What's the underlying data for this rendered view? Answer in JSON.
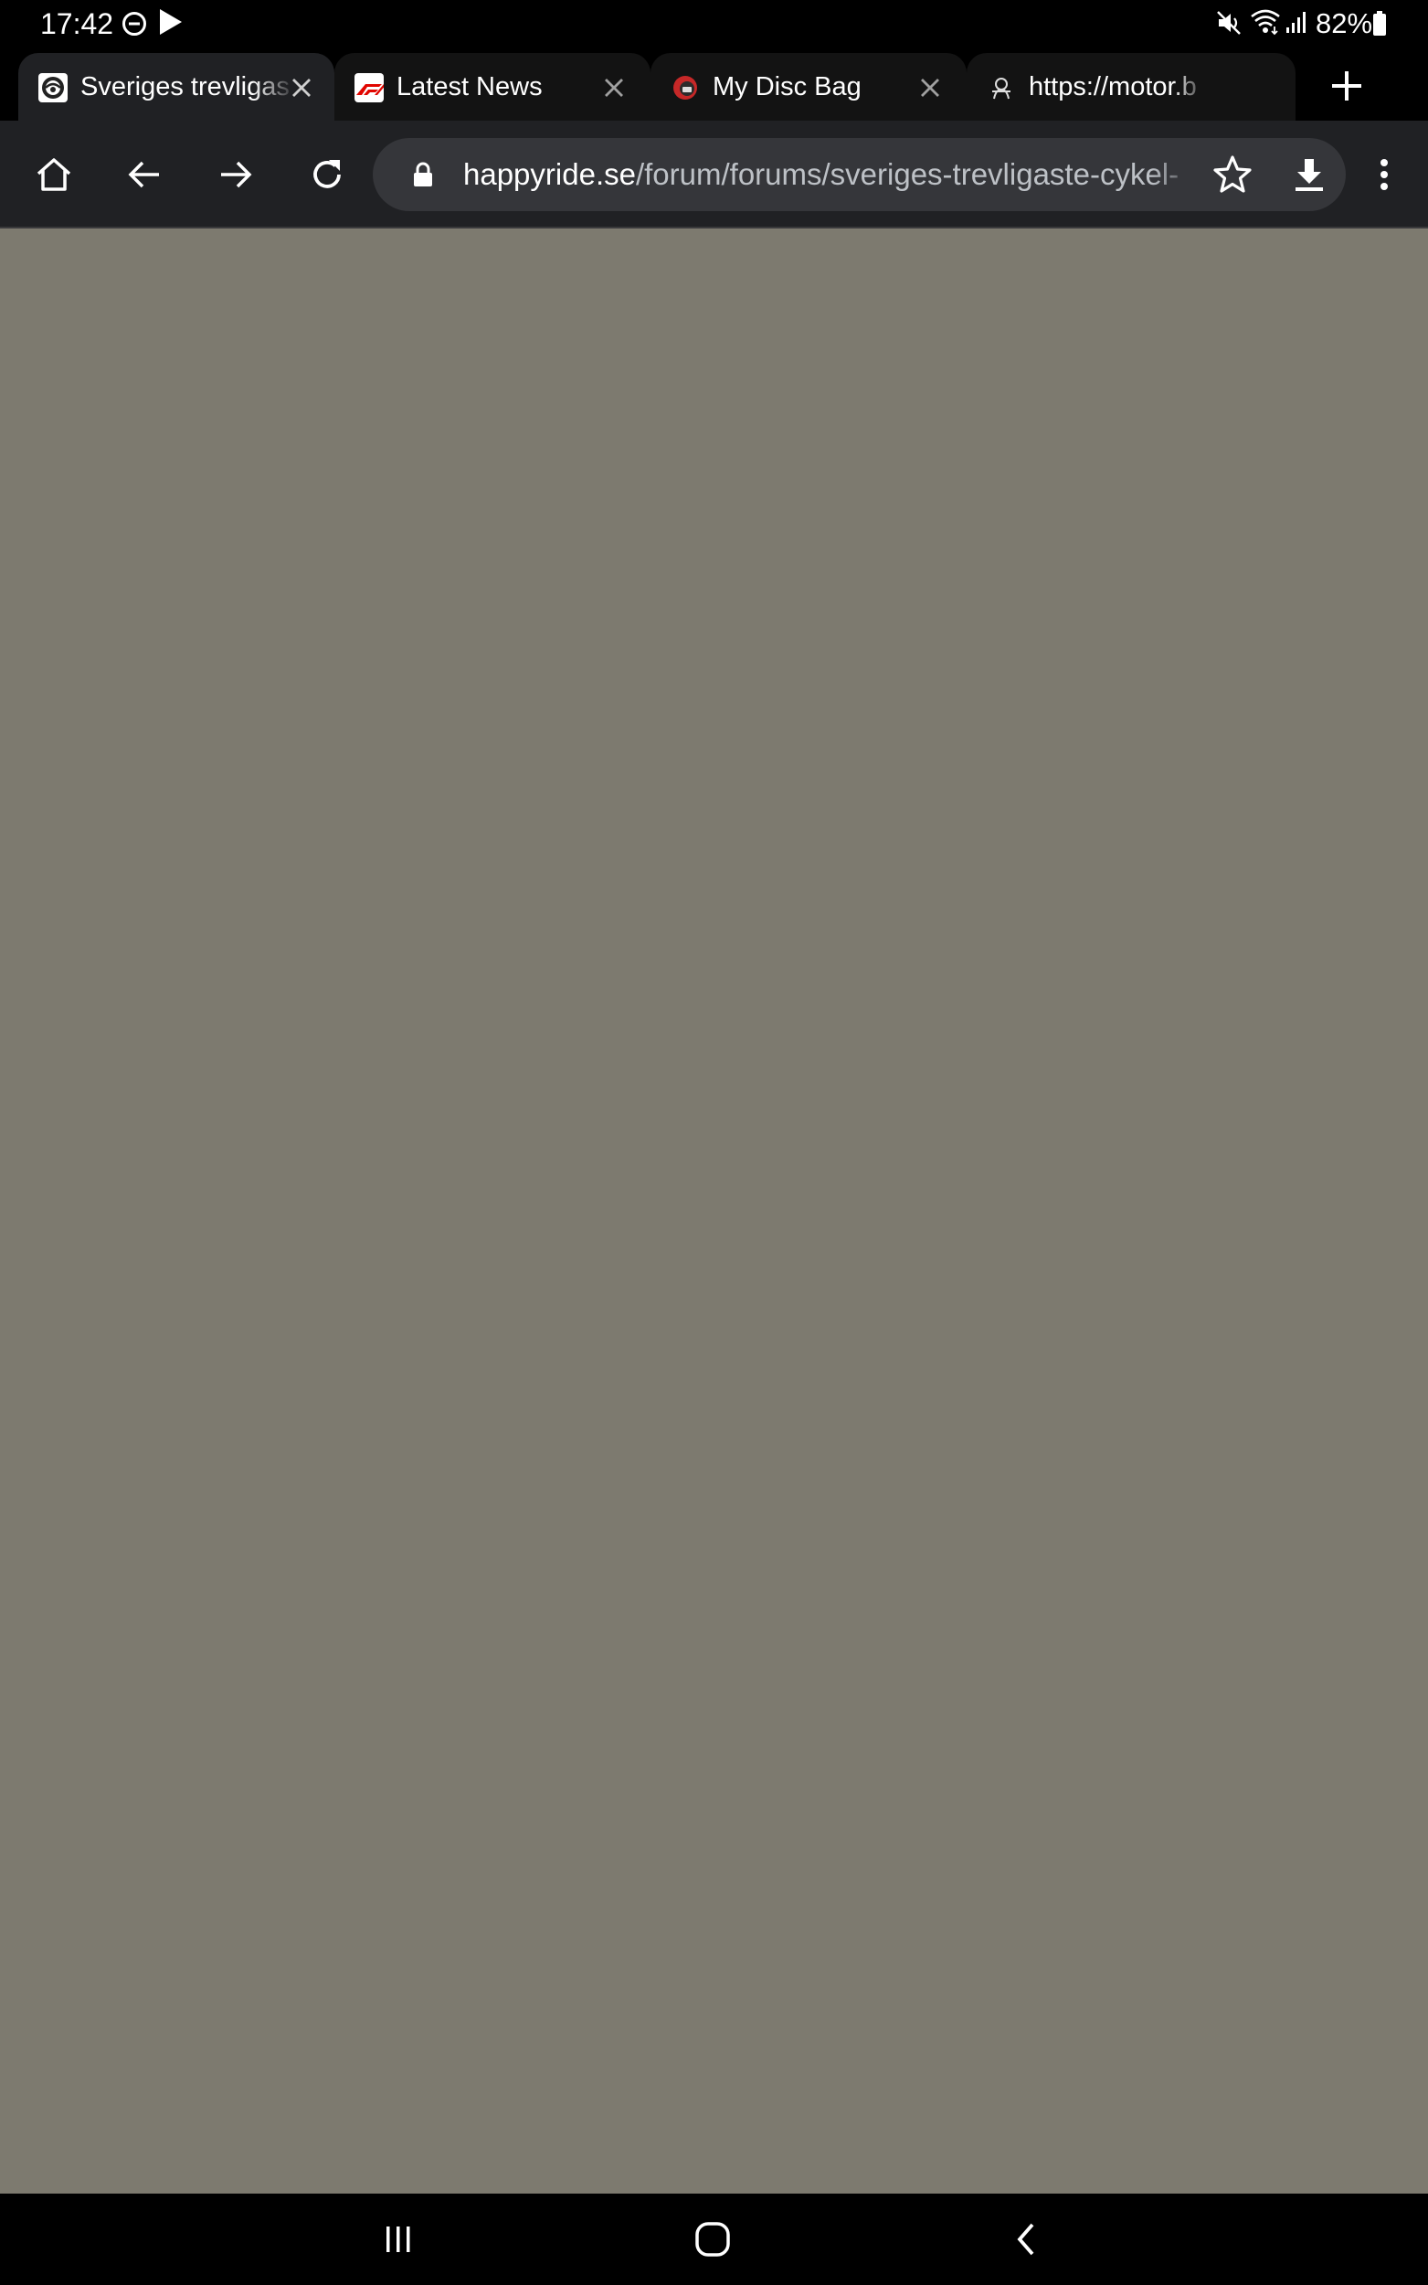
{
  "status_bar": {
    "time": "17:42",
    "battery_text": "82%",
    "icons": [
      "do-not-disturb-icon",
      "play-icon",
      "mute-icon",
      "wifi-icon",
      "signal-icon",
      "battery-icon"
    ]
  },
  "tabs": [
    {
      "title": "Sveriges trevligas",
      "favicon": "happyride-favicon",
      "active": true
    },
    {
      "title": "Latest News",
      "favicon": "f1-favicon",
      "active": false
    },
    {
      "title": "My Disc Bag",
      "favicon": "disc-bag-favicon",
      "active": false
    },
    {
      "title": "https://motor.b",
      "favicon": "motor-favicon",
      "active": false
    }
  ],
  "toolbar": {
    "url_host": "happyride.se",
    "url_path": "/forum/forums/sveriges-trevligaste-cykel-",
    "icons": [
      "home-icon",
      "back-icon",
      "forward-icon",
      "reload-icon",
      "lock-icon",
      "star-icon",
      "download-icon",
      "more-menu-icon"
    ]
  },
  "colors": {
    "page_background": "#7d7a6f",
    "toolbar": "#202124",
    "omnibox": "#35363a",
    "f1_red": "#e10600"
  },
  "nav_bar": {
    "icons": [
      "recent-apps-icon",
      "home-nav-icon",
      "back-nav-icon"
    ]
  }
}
